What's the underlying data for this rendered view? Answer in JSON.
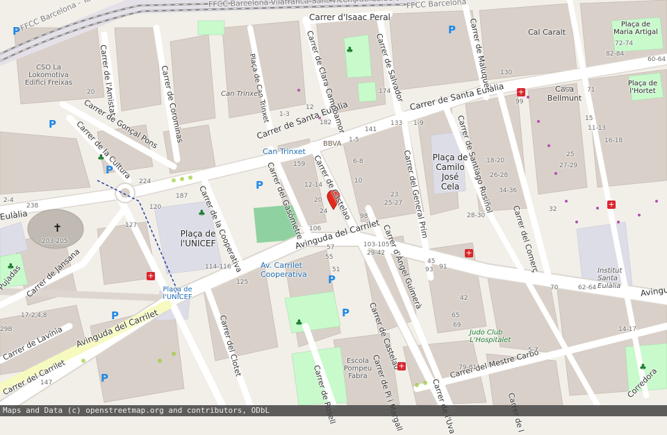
{
  "attribution": "Maps and Data (c) openstreetmap.org and contributors, ODbL",
  "colors": {
    "background": "#f2efe9",
    "building": "#d9d0c9",
    "building_stroke": "#c5bbb3",
    "road": "#ffffff",
    "road_casing": "#e2ddd6",
    "park": "#c8facc",
    "pedestrian": "#dddde8",
    "railway": "#8a8a8a",
    "secondary_road": "#f7fabf",
    "marker": "#e22a1e"
  },
  "streets": [
    {
      "name": "Carrer d'Isaac Peral"
    },
    {
      "name": "Carrer de Santa Eulàlia"
    },
    {
      "name": "Carrer de Santa Eulàlia"
    },
    {
      "name": "Carrer de Salvador"
    },
    {
      "name": "Carrer de Maluquer"
    },
    {
      "name": "Carrer de l'Amistat"
    },
    {
      "name": "Carrer de Corominas"
    },
    {
      "name": "Carrer de Clara Campoamor"
    },
    {
      "name": "Plaça de Can Trinxet"
    },
    {
      "name": "Carrer de Gonçal Pons"
    },
    {
      "name": "Carrer de la Cultura"
    },
    {
      "name": "Carrer de la Cooperativa"
    },
    {
      "name": "Carrer del Gasòmetre"
    },
    {
      "name": "Carrer de Castelao"
    },
    {
      "name": "Carrer de Castelao"
    },
    {
      "name": "Carrer d'Àngel Guimerà"
    },
    {
      "name": "Carrer del General Prim"
    },
    {
      "name": "Carrer de Santiago Rusiñol"
    },
    {
      "name": "Carrer del Comerç"
    },
    {
      "name": "Avinguda del Carrilet"
    },
    {
      "name": "Avinguda del Carrilet"
    },
    {
      "name": "Avinguda"
    },
    {
      "name": "Carrer de Jansana"
    },
    {
      "name": "Carrer de Lavínia"
    },
    {
      "name": "Carrer del Carrilet"
    },
    {
      "name": "Carrer del Clotet"
    },
    {
      "name": "Carrer de Rosell"
    },
    {
      "name": "Carrer de Pi i Margall"
    },
    {
      "name": "Carrer de l'Uva"
    },
    {
      "name": "Carrer del Mestre Carbó"
    },
    {
      "name": "Eulàlia"
    },
    {
      "name": "Pujadas"
    },
    {
      "name": "Carrer de Santa Eulàlia"
    },
    {
      "name": "Corredora"
    },
    {
      "name": "Carrer de l"
    }
  ],
  "rail_labels": [
    {
      "name": "FFCC Barcelona - Tarragona"
    },
    {
      "name": "FFCC Barcelona-Vilafranca-Sant Vicenç de Calders"
    },
    {
      "name": "FFCC Barcelona"
    }
  ],
  "places": [
    {
      "name": "Plaça de l'UNICEF"
    },
    {
      "name": "Plaça de Camilo José Cela"
    },
    {
      "name": "Plaça de Maria Artigal"
    },
    {
      "name": "Plaça de l'Hortet"
    },
    {
      "name": "Cal Caralt"
    },
    {
      "name": "Casa Bellmunt"
    }
  ],
  "pois": [
    {
      "name": "Can Trinxet"
    },
    {
      "name": "Institut Santa Eulàlia"
    },
    {
      "name": "Escola Pompeu Fabra"
    },
    {
      "name": "CSO La Lokomotiva Edifici Freixas"
    }
  ],
  "amenities": [
    {
      "name": "Judo Club L'Hospitalet"
    }
  ],
  "stations": [
    {
      "name": "Can Trinxet"
    },
    {
      "name": "Av. Carrilet Cooperativa"
    },
    {
      "name": "Plaça de l'UNICEF"
    }
  ],
  "brands": [
    {
      "name": "BBVA"
    }
  ],
  "house_numbers": [
    {
      "text": "12"
    },
    {
      "text": "182"
    },
    {
      "text": "141"
    },
    {
      "text": "133"
    },
    {
      "text": "1-9"
    },
    {
      "text": "1-3"
    },
    {
      "text": "159"
    },
    {
      "text": "12-14"
    },
    {
      "text": "20"
    },
    {
      "text": "24"
    },
    {
      "text": "106"
    },
    {
      "text": "98"
    },
    {
      "text": "103-105"
    },
    {
      "text": "29-42"
    },
    {
      "text": "57"
    },
    {
      "text": "55"
    },
    {
      "text": "51"
    },
    {
      "text": "125"
    },
    {
      "text": "114-116"
    },
    {
      "text": "127"
    },
    {
      "text": "120"
    },
    {
      "text": "187"
    },
    {
      "text": "224"
    },
    {
      "text": "238"
    },
    {
      "text": "203-205"
    },
    {
      "text": "174"
    },
    {
      "text": "130"
    },
    {
      "text": "99"
    },
    {
      "text": "77"
    },
    {
      "text": "71"
    },
    {
      "text": "82-84"
    },
    {
      "text": "72-74"
    },
    {
      "text": "60-64"
    },
    {
      "text": "25"
    },
    {
      "text": "27-29"
    },
    {
      "text": "18-20"
    },
    {
      "text": "26-28"
    },
    {
      "text": "34-36"
    },
    {
      "text": "28-30"
    },
    {
      "text": "32"
    },
    {
      "text": "45"
    },
    {
      "text": "93"
    },
    {
      "text": "91"
    },
    {
      "text": "70"
    },
    {
      "text": "62-64"
    },
    {
      "text": "14-17"
    },
    {
      "text": "29B"
    },
    {
      "text": "17-2,4,8"
    },
    {
      "text": "147"
    },
    {
      "text": "20"
    },
    {
      "text": "15"
    },
    {
      "text": "11-13"
    },
    {
      "text": "16-18"
    },
    {
      "text": "5-7"
    },
    {
      "text": "79-81"
    },
    {
      "text": "65"
    },
    {
      "text": "69"
    },
    {
      "text": "42"
    },
    {
      "text": "2-4"
    },
    {
      "text": "1-5"
    },
    {
      "text": "6-8"
    },
    {
      "text": "23"
    },
    {
      "text": "25-27"
    },
    {
      "text": "10"
    }
  ],
  "icons": [
    {
      "name": "parking-icon",
      "glyph": "P"
    },
    {
      "name": "health-icon",
      "glyph": "+"
    },
    {
      "name": "church-icon",
      "glyph": "✝"
    },
    {
      "name": "playground-icon",
      "glyph": "♣"
    }
  ]
}
